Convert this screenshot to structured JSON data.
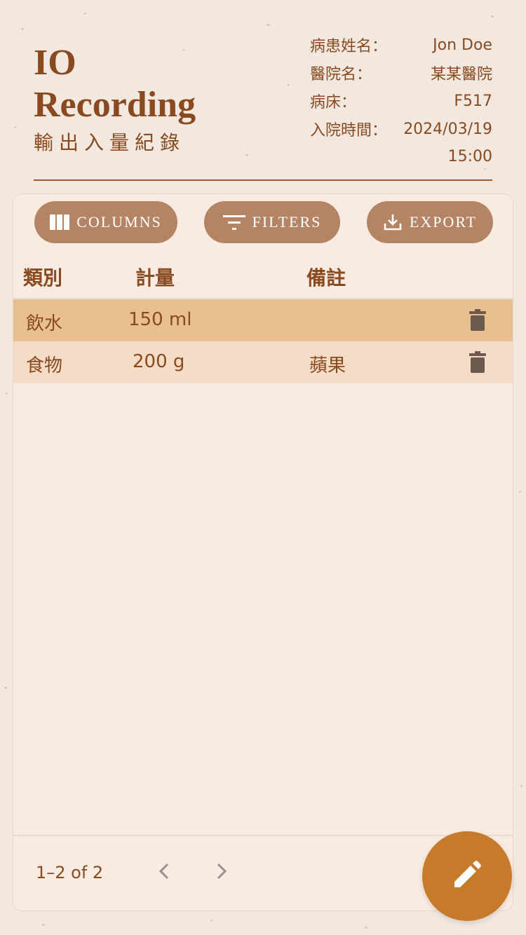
{
  "header": {
    "title_line1": "IO",
    "title_line2": "Recording",
    "subtitle": "輸出入量紀錄"
  },
  "patient_info": {
    "name_label": "病患姓名：",
    "name_value": "Jon Doe",
    "hospital_label": "醫院名：",
    "hospital_value": "某某醫院",
    "bed_label": "病床：",
    "bed_value": "F517",
    "admit_label": "入院時間：",
    "admit_date": "2024/03/19",
    "admit_time": "15:00"
  },
  "toolbar": {
    "columns_label": "COLUMNS",
    "filters_label": "FILTERS",
    "export_label": "EXPORT"
  },
  "table": {
    "columns": [
      "類別",
      "計量",
      "備註"
    ],
    "rows": [
      {
        "category": "飲水",
        "amount": "150 ml",
        "note": ""
      },
      {
        "category": "食物",
        "amount": "200 g",
        "note": "蘋果"
      }
    ]
  },
  "pagination": {
    "range": "1–2 of 2"
  },
  "icons": {
    "columns": "columns-icon",
    "filters": "filter-icon",
    "export": "download-icon",
    "delete": "trash-icon",
    "prev": "chevron-left-icon",
    "next": "chevron-right-icon",
    "fab": "pencil-icon"
  },
  "colors": {
    "background": "#f2e8e0",
    "brand_text": "#8a4a1f",
    "button": "#b48465",
    "row_highlight": "#e8c090",
    "row_alt": "#f5dcc6",
    "fab": "#c87a2b"
  }
}
